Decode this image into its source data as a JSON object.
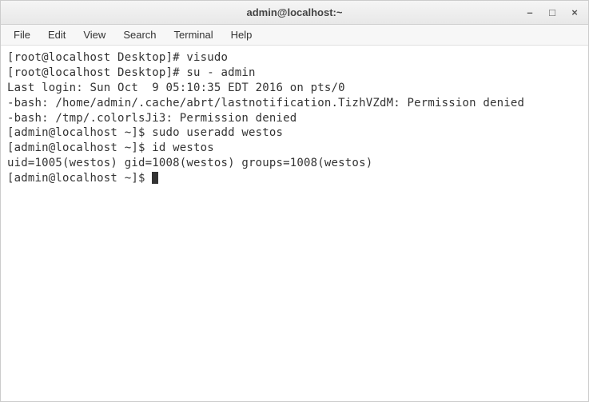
{
  "titlebar": {
    "title": "admin@localhost:~"
  },
  "window_controls": {
    "minimize": "–",
    "maximize": "□",
    "close": "×"
  },
  "menubar": {
    "file": "File",
    "edit": "Edit",
    "view": "View",
    "search": "Search",
    "terminal": "Terminal",
    "help": "Help"
  },
  "terminal": {
    "lines": [
      "[root@localhost Desktop]# visudo",
      "[root@localhost Desktop]# su - admin",
      "Last login: Sun Oct  9 05:10:35 EDT 2016 on pts/0",
      "-bash: /home/admin/.cache/abrt/lastnotification.TizhVZdM: Permission denied",
      "-bash: /tmp/.colorlsJi3: Permission denied",
      "[admin@localhost ~]$ sudo useradd westos",
      "[admin@localhost ~]$ id westos",
      "uid=1005(westos) gid=1008(westos) groups=1008(westos)",
      "[admin@localhost ~]$ "
    ]
  }
}
